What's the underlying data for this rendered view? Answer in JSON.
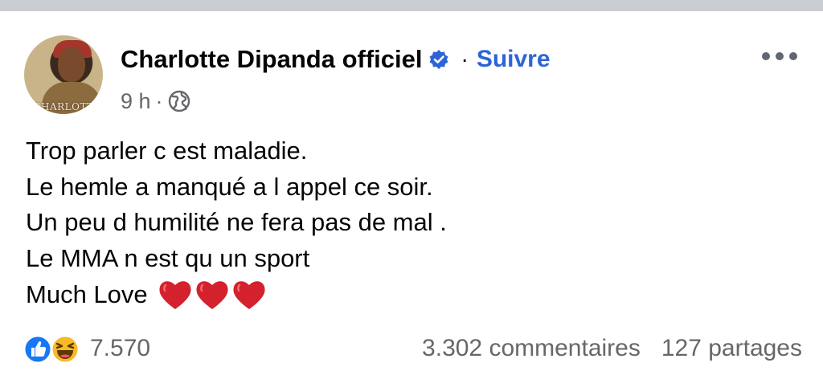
{
  "post": {
    "author": "Charlotte Dipanda officiel",
    "follow_label": "Suivre",
    "separator": "·",
    "time": "9 h",
    "avatar_text": "CHARLOTT",
    "lines": [
      "Trop parler c est maladie.",
      "Le hemle a manqué a l appel ce soir.",
      "Un peu d humilité ne fera pas de mal .",
      "Le MMA n est qu un sport"
    ],
    "closing": "Much Love"
  },
  "stats": {
    "reaction_count": "7.570",
    "comments": "3.302 commentaires",
    "shares": "127 partages"
  },
  "colors": {
    "accent": "#2d64d8",
    "meta_gray": "#65676b",
    "heart": "#d3212d",
    "like_blue": "#1877f2",
    "haha_yellow": "#f7b928"
  },
  "icons": [
    "verified-badge-icon",
    "more-options-icon",
    "globe-icon",
    "heart-icon",
    "like-reaction-icon",
    "haha-reaction-icon"
  ]
}
